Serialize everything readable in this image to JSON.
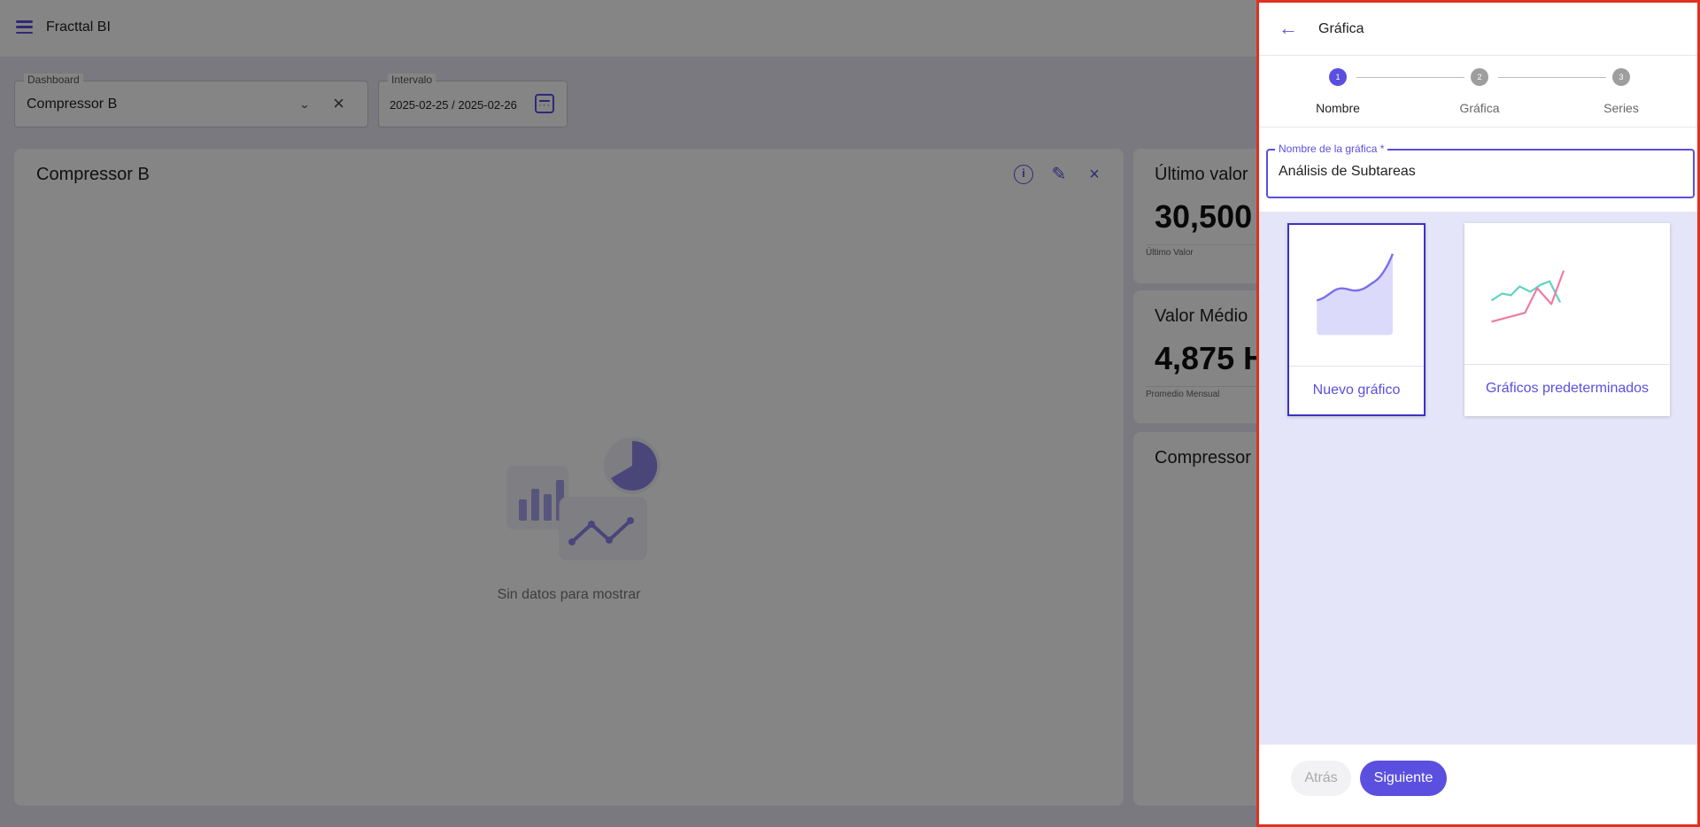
{
  "app": {
    "title": "Fracttal BI"
  },
  "filters": {
    "dashboard_label": "Dashboard",
    "dashboard_value": "Compressor B",
    "interval_label": "Intervalo",
    "interval_value": "2025-02-25 / 2025-02-26"
  },
  "main_card": {
    "title": "Compressor B",
    "empty_text": "Sin datos para mostrar"
  },
  "side_cards": [
    {
      "title": "Último valor",
      "value": "30,500",
      "caption": "Último Valor"
    },
    {
      "title": "Valor Médio",
      "value": "4,875 H",
      "caption": "Promedio Mensual"
    },
    {
      "title": "Compressor"
    }
  ],
  "drawer": {
    "title": "Gráfica",
    "steps": [
      {
        "number": "1",
        "label": "Nombre"
      },
      {
        "number": "2",
        "label": "Gráfica"
      },
      {
        "number": "3",
        "label": "Series"
      }
    ],
    "name_field": {
      "label": "Nombre de la gráfica *",
      "value": "Análisis de Subtareas"
    },
    "options": [
      {
        "label": "Nuevo gráfico"
      },
      {
        "label": "Gráficos predeterminados"
      }
    ],
    "back_label": "Atrás",
    "next_label": "Siguiente"
  },
  "colors": {
    "accent": "#5b4fe0",
    "drawer_border": "#e0301e",
    "options_bg": "#e5e5f9",
    "line_teal": "#5fd3c4",
    "line_pink": "#f07aa0"
  }
}
